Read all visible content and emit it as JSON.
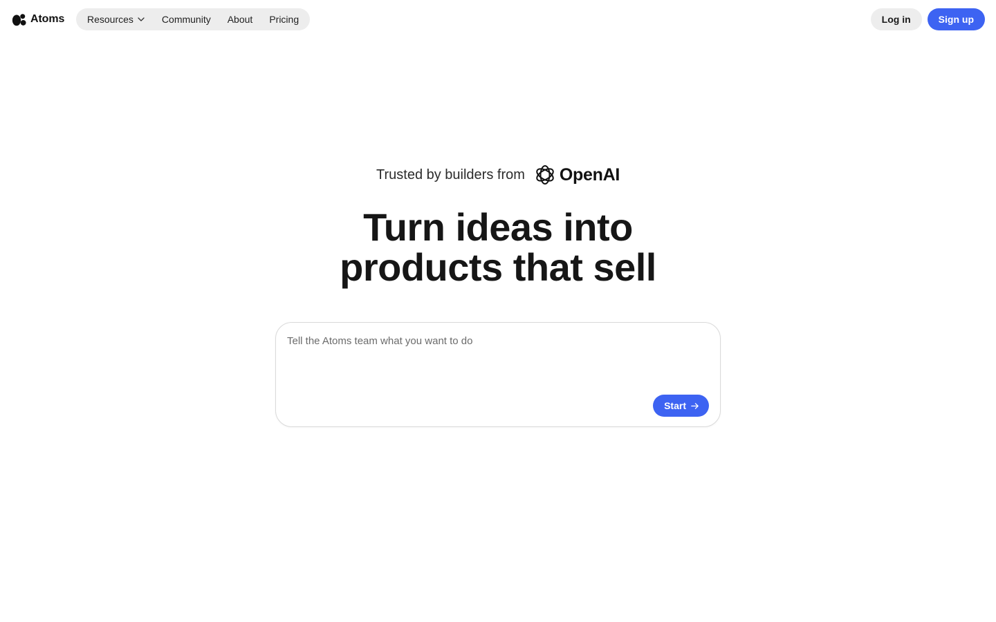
{
  "brand": {
    "name": "Atoms",
    "logo_icon": "atoms-logo-icon"
  },
  "nav": {
    "items": [
      {
        "label": "Resources",
        "has_dropdown": true
      },
      {
        "label": "Community"
      },
      {
        "label": "About"
      },
      {
        "label": "Pricing"
      }
    ]
  },
  "auth": {
    "login_label": "Log in",
    "signup_label": "Sign up"
  },
  "trusted": {
    "text": "Trusted by builders from",
    "company": "OpenAI",
    "company_icon": "openai-icon"
  },
  "hero": {
    "line1": "Turn ideas into",
    "line2": "products that sell"
  },
  "prompt": {
    "placeholder": "Tell the Atoms team what you want to do",
    "value": "",
    "start_label": "Start"
  },
  "colors": {
    "accent": "#3d63f2",
    "pill_bg": "#ededed",
    "text": "#161616"
  }
}
